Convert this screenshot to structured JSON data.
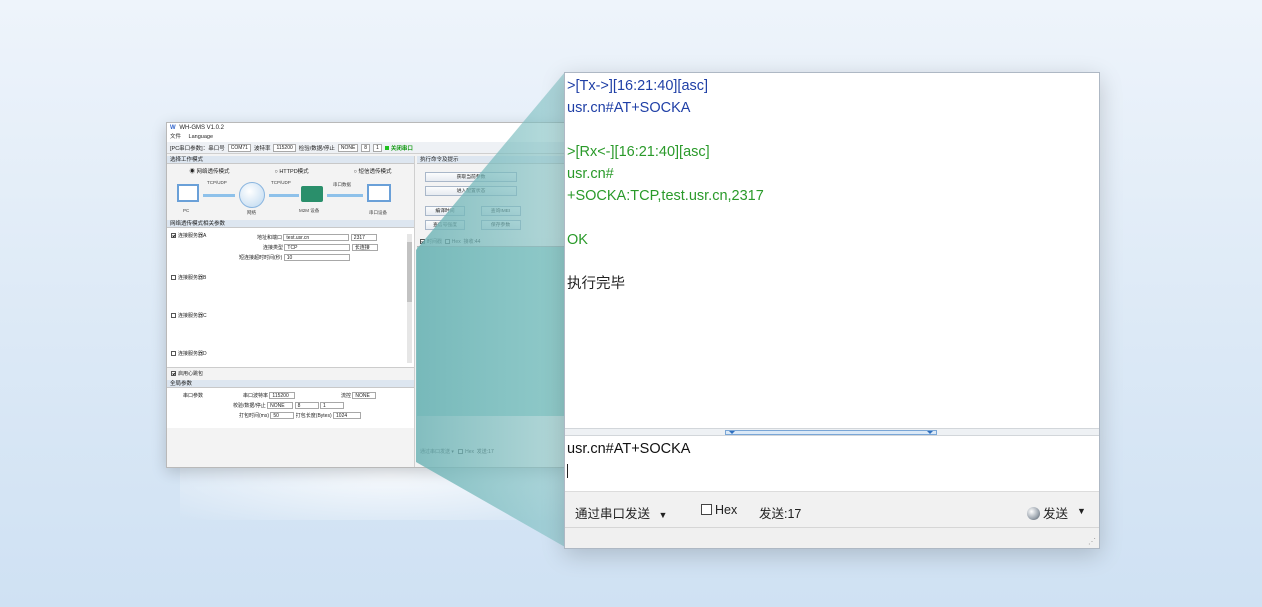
{
  "small_window": {
    "title": "WH-GMS V1.0.2",
    "menu": [
      "文件",
      "Language"
    ],
    "toolbar": {
      "serial_label": "[PC串口参数]：串口号",
      "port": "COM71",
      "baud_label": "波特率",
      "baud": "115200",
      "parity_label": "检验/数据/停止",
      "parity": "NONE",
      "data_bits": "8",
      "stop_bits": "1",
      "close_button": "关闭串口"
    },
    "work_mode_title": "选择工作模式",
    "modes": [
      "网络透传模式",
      "HTTPD模式",
      "短信透传模式"
    ],
    "diagram_labels": {
      "tcp1": "TCP/UDP",
      "tcp2": "TCP/UDP",
      "serial": "串口数据",
      "pc": "PC",
      "network": "网络",
      "m2m": "M2M 设备",
      "serial_dev": "串口设备"
    },
    "params_title": "网络透传模式相关参数",
    "server_a": "连接服务器A",
    "server_b": "连接服务器B",
    "server_c": "连接服务器C",
    "server_d": "连接服务器D",
    "heartbeat": "启用心跳包",
    "addr_label": "地址和端口",
    "addr": "test.usr.cn",
    "port": "2317",
    "conn_type_label": "连接类型",
    "conn_type": "TCP",
    "long_conn": "长连接",
    "timeout_label": "短连接超时时间(秒)",
    "timeout": "10",
    "global_title": "全局参数",
    "serial_params": "串口参数",
    "serial_baud_label": "串口波特率",
    "serial_baud": "115200",
    "flow_label": "流控",
    "flow": "NONE",
    "parity_label2": "校验/数据/停止",
    "parity2": "NONE",
    "data2": "8",
    "stop2": "1",
    "pack_time_label": "打包时间(ms)",
    "pack_time": "50",
    "pack_len_label": "打包长度(Bytes)",
    "pack_len": "1024",
    "cmd_title": "执行命令及提示",
    "buttons": {
      "get_params": "获取当前参数",
      "enter_config": "进入配置状态",
      "compile_time": "编译时间",
      "query_imei": "查询IMEI",
      "signal": "查信号强度",
      "save": "保存参数"
    },
    "rx_toolbar": {
      "timestamp": "时间戳",
      "hex": "Hex",
      "recv": "接收:44"
    },
    "tx_toolbar": {
      "send_mode": "通过串口发送",
      "hex": "Hex",
      "sent": "发送:17"
    }
  },
  "log": {
    "lines": [
      {
        "text": ">[Tx->][16:21:40][asc]",
        "type": "tx"
      },
      {
        "text": "usr.cn#AT+SOCKA",
        "type": "tx"
      },
      {
        "text": "",
        "type": "blank"
      },
      {
        "text": ">[Rx<-][16:21:40][asc]",
        "type": "rx"
      },
      {
        "text": "usr.cn#",
        "type": "rx"
      },
      {
        "text": "+SOCKA:TCP,test.usr.cn,2317",
        "type": "rx"
      },
      {
        "text": "",
        "type": "blank"
      },
      {
        "text": "OK",
        "type": "rx"
      },
      {
        "text": "",
        "type": "blank"
      },
      {
        "text": "执行完毕",
        "type": "plain"
      }
    ]
  },
  "send_area": {
    "value": "usr.cn#AT+SOCKA"
  },
  "bottom_bar": {
    "send_mode": "通过串口发送",
    "hex": "Hex",
    "sent": "发送:17",
    "send_button": "发送"
  },
  "colors": {
    "tx": "#1f3fa6",
    "rx": "#2a9a2a",
    "rx_panel": "#a4d4d0"
  }
}
